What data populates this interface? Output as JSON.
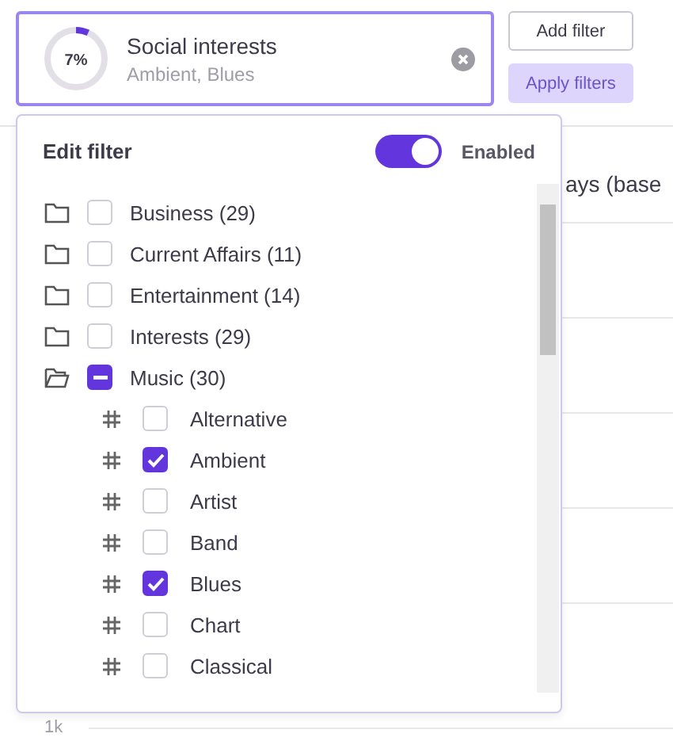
{
  "filter_card": {
    "progress": {
      "level": 0.07,
      "label": "7%"
    },
    "title": "Social interests",
    "summary": "Ambient, Blues"
  },
  "buttons": [
    {
      "label": "Add filter",
      "disabled": false
    },
    {
      "label": "Apply filters",
      "disabled": true
    }
  ],
  "background": {
    "heading": "ays (base",
    "axis_label": "1k"
  },
  "popover": {
    "title": "Edit filter",
    "toggle": {
      "on": true,
      "label": "Enabled"
    },
    "tree": [
      {
        "label": "Business (29)",
        "checked": false,
        "indeterminate": false,
        "expanded": false
      },
      {
        "label": "Current Affairs (11)",
        "checked": false,
        "indeterminate": false,
        "expanded": false
      },
      {
        "label": "Entertainment (14)",
        "checked": false,
        "indeterminate": false,
        "expanded": false
      },
      {
        "label": "Interests (29)",
        "checked": false,
        "indeterminate": false,
        "expanded": false
      },
      {
        "label": "Music (30)",
        "checked": false,
        "indeterminate": true,
        "expanded": true,
        "children": [
          {
            "label": "Alternative",
            "checked": false
          },
          {
            "label": "Ambient",
            "checked": true
          },
          {
            "label": "Artist",
            "checked": false
          },
          {
            "label": "Band",
            "checked": false
          },
          {
            "label": "Blues",
            "checked": true
          },
          {
            "label": "Chart",
            "checked": false
          },
          {
            "label": "Classical",
            "checked": false
          }
        ]
      }
    ]
  }
}
